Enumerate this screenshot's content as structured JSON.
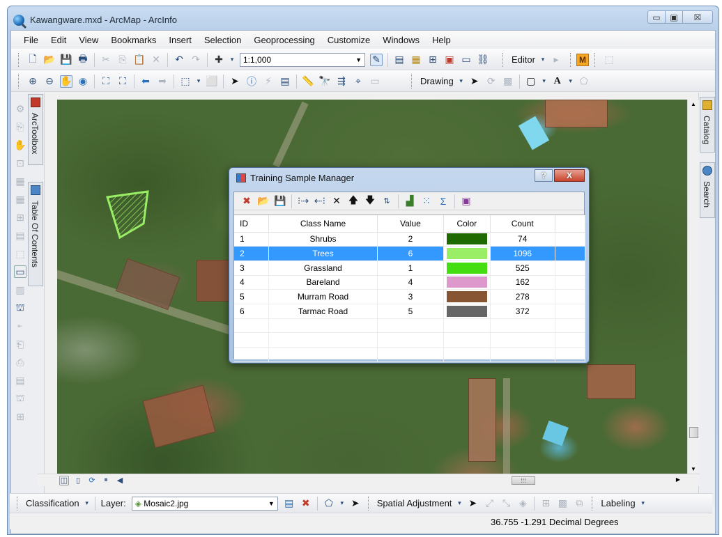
{
  "window": {
    "title": "Kawangware.mxd - ArcMap - ArcInfo",
    "controls": {
      "minimize": "▭",
      "maximize": "▣",
      "close": "☒"
    }
  },
  "menu": [
    "File",
    "Edit",
    "View",
    "Bookmarks",
    "Insert",
    "Selection",
    "Geoprocessing",
    "Customize",
    "Windows",
    "Help"
  ],
  "toolbar_standard": {
    "scale": "1:1,000",
    "editor_label": "Editor"
  },
  "toolbar_tools": {
    "drawing_label": "Drawing",
    "text_tool": "A"
  },
  "left_dock": {
    "tab_toolbox": "ArcToolbox",
    "tab_toc": "Table Of Contents"
  },
  "right_dock": {
    "tab_catalog": "Catalog",
    "tab_search": "Search"
  },
  "bottom_toolbar": {
    "classification_label": "Classification",
    "layer_label": "Layer:",
    "layer_value": "Mosaic2.jpg",
    "spatial_adjustment_label": "Spatial Adjustment",
    "labeling_label": "Labeling"
  },
  "status": {
    "coordinates": "36.755  -1.291 Decimal Degrees"
  },
  "dialog": {
    "title": "Training Sample Manager",
    "help": "?",
    "close": "X",
    "columns": [
      "ID",
      "Class Name",
      "Value",
      "Color",
      "Count"
    ],
    "rows": [
      {
        "id": "1",
        "class_name": "Shrubs",
        "value": "2",
        "color": "#1e6a00",
        "count": "74"
      },
      {
        "id": "2",
        "class_name": "Trees",
        "value": "6",
        "color": "#99ee66",
        "count": "1096",
        "selected": true
      },
      {
        "id": "3",
        "class_name": "Grassland",
        "value": "1",
        "color": "#44dd11",
        "count": "525"
      },
      {
        "id": "4",
        "class_name": "Bareland",
        "value": "4",
        "color": "#dd99cc",
        "count": "162"
      },
      {
        "id": "5",
        "class_name": "Murram Road",
        "value": "3",
        "color": "#885533",
        "count": "278"
      },
      {
        "id": "6",
        "class_name": "Tarmac Road",
        "value": "5",
        "color": "#666666",
        "count": "372"
      }
    ]
  }
}
